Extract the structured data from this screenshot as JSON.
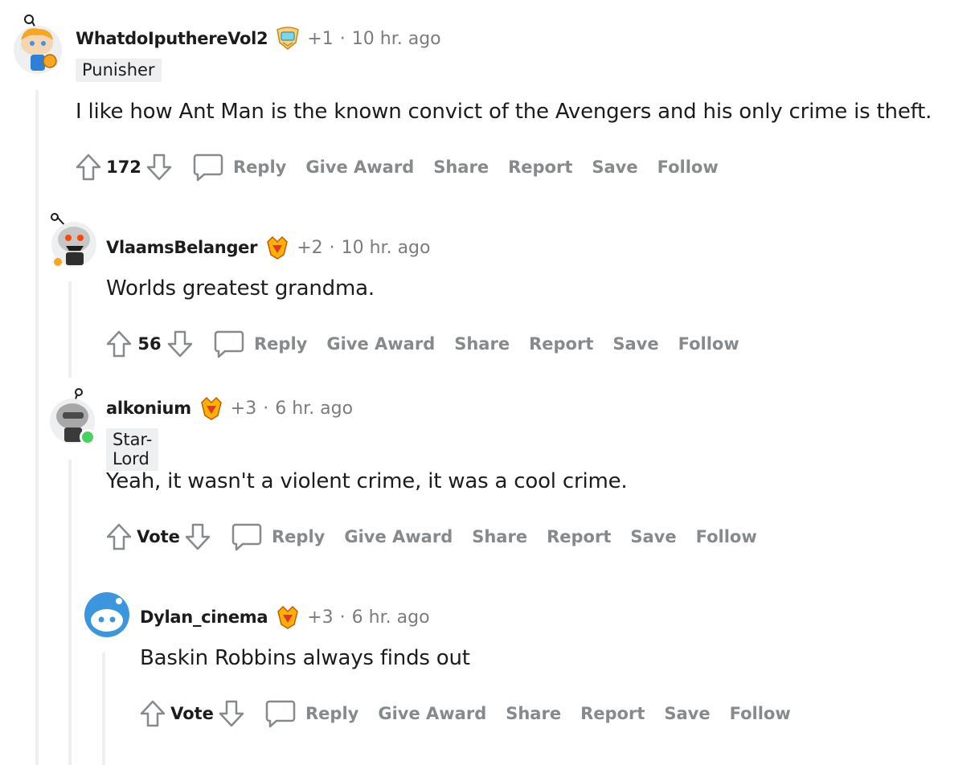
{
  "comments": [
    {
      "username": "WhatdoIputhereVol2",
      "score_tag": "+1",
      "time": "10 hr. ago",
      "flair": "Punisher",
      "body": "I like how Ant Man is the known convict of the Avengers and his only crime is theft.",
      "votes": "172"
    },
    {
      "username": "VlaamsBelanger",
      "score_tag": "+2",
      "time": "10 hr. ago",
      "flair": "",
      "body": "Worlds greatest grandma.",
      "votes": "56"
    },
    {
      "username": "alkonium",
      "score_tag": "+3",
      "time": "6 hr. ago",
      "flair": "Star-Lord",
      "body": "Yeah, it wasn't a violent crime, it was a cool crime.",
      "votes": "Vote"
    },
    {
      "username": "Dylan_cinema",
      "score_tag": "+3",
      "time": "6 hr. ago",
      "flair": "",
      "body": "Baskin Robbins always finds out",
      "votes": "Vote"
    }
  ],
  "actions": {
    "reply": "Reply",
    "give_award": "Give Award",
    "share": "Share",
    "report": "Report",
    "save": "Save",
    "follow": "Follow"
  },
  "separator": "·",
  "colors": {
    "meta_gray": "#7c7c7c",
    "action_gray": "#878a8c",
    "thread_line": "#edeff1",
    "online": "#46d160"
  }
}
